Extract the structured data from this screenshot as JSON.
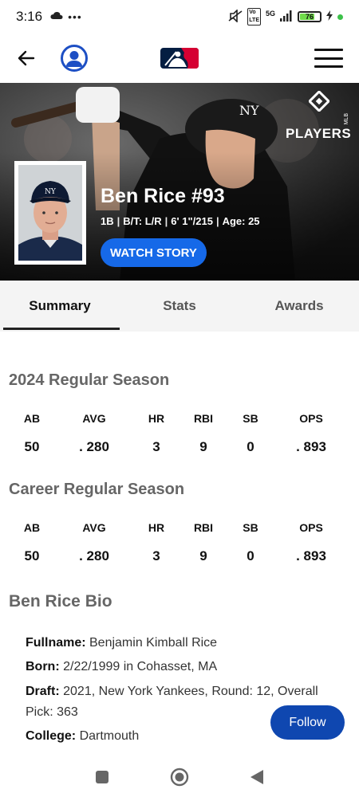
{
  "status_bar": {
    "time": "3:16",
    "network": "5G",
    "battery_level": "76",
    "battery_fraction": 0.76
  },
  "header": {
    "icons": [
      "back-arrow-icon",
      "profile-icon",
      "mlb-logo",
      "menu-icon"
    ]
  },
  "hero": {
    "badge_text": "PLAYERS",
    "badge_prefix": "MLB",
    "name": "Ben Rice #93",
    "meta": [
      "1B",
      "B/T: L/R",
      "6' 1\"/215",
      "Age: 25"
    ],
    "watch_label": "WATCH STORY"
  },
  "tabs": [
    {
      "label": "Summary",
      "active": true
    },
    {
      "label": "Stats",
      "active": false
    },
    {
      "label": "Awards",
      "active": false
    }
  ],
  "season": {
    "title": "2024 Regular Season",
    "headers": [
      "AB",
      "AVG",
      "HR",
      "RBI",
      "SB",
      "OPS"
    ],
    "values": [
      "50",
      ". 280",
      "3",
      "9",
      "0",
      ". 893"
    ]
  },
  "career": {
    "title": "Career Regular Season",
    "headers": [
      "AB",
      "AVG",
      "HR",
      "RBI",
      "SB",
      "OPS"
    ],
    "values": [
      "50",
      ". 280",
      "3",
      "9",
      "0",
      ". 893"
    ]
  },
  "bio": {
    "title": "Ben Rice Bio",
    "items": [
      {
        "label": "Fullname:",
        "value": " Benjamin Kimball Rice"
      },
      {
        "label": "Born:",
        "value": " 2/22/1999 in Cohasset, MA"
      },
      {
        "label": "Draft:",
        "value": " 2021, New York Yankees, Round: 12, Overall Pick: 363"
      },
      {
        "label": "College:",
        "value": " Dartmouth"
      }
    ]
  },
  "follow_label": "Follow",
  "colors": {
    "accent_blue": "#1669e8",
    "follow_blue": "#0f47b0",
    "profile_blue": "#1d4fc4",
    "mlb_red": "#d50032",
    "mlb_navy": "#041e42"
  }
}
